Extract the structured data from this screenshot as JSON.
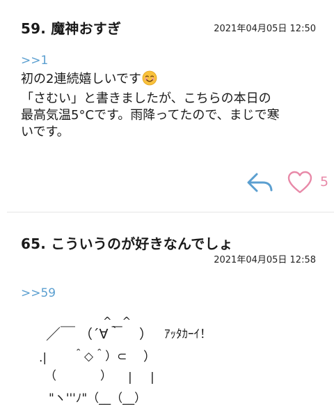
{
  "posts": [
    {
      "number_title": "59.  魔神おすぎ",
      "timestamp": "2021年04月05日 12:50",
      "reply_ref": ">>1",
      "body_lines": [
        "初の2連続嬉しいです",
        "「さむい」と書きましたが、こちらの本日の",
        "最高気温5°Cです。雨降ってたので、まじで寒",
        "いです。"
      ],
      "emoji": "smiling-face-emoji",
      "reply_icon": "reply-arrow-icon",
      "like_icon": "heart-outline-icon",
      "like_count": "5"
    },
    {
      "number_title": "65.  こういうのが好きなんでしょ",
      "timestamp": "2021年04月05日 12:58",
      "reply_ref": ">>59",
      "ascii_art": {
        "l1": "^__^",
        "l2a": "／￣",
        "l2b": "（´∀｀",
        "l2c": "）",
        "l2d": "ｱｯﾀｶｰｲ！",
        "l3a": ".|",
        "l3b": "＾◇＾）⊂",
        "l3c": "）",
        "l4a": "（",
        "l4b": "）",
        "l4c": "|",
        "l4d": "|",
        "l5": "\"ヽ'''ﾉ\"（__（__）"
      }
    }
  ],
  "colors": {
    "link": "#5b9fd0",
    "like": "#e889a8",
    "reply_icon": "#5b9fd0",
    "divider": "#e6e6e6"
  }
}
